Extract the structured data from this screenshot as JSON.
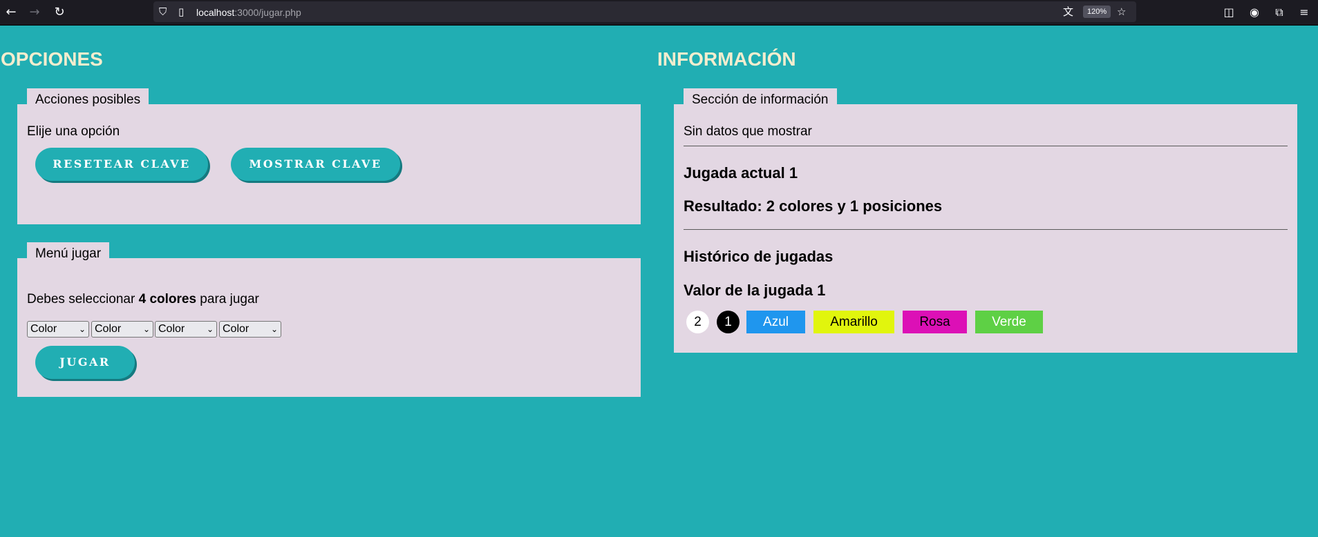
{
  "browser": {
    "url_host": "localhost",
    "url_path": ":3000/jugar.php",
    "zoom": "120%"
  },
  "opciones": {
    "title": "OPCIONES",
    "acciones": {
      "legend": "Acciones posibles",
      "prompt": "Elije una opción",
      "reset_label": "RESETEAR CLAVE",
      "show_label": "MOSTRAR CLAVE"
    },
    "menu": {
      "legend": "Menú jugar",
      "instr_before": "Debes seleccionar ",
      "instr_bold": "4 colores",
      "instr_after": " para jugar",
      "selects": [
        "Color",
        "Color",
        "Color",
        "Color"
      ],
      "play_label": "JUGAR"
    }
  },
  "informacion": {
    "title": "INFORMACIÓN",
    "legend": "Sección de información",
    "empty": "Sin datos que mostrar",
    "jugada_actual": "Jugada actual 1",
    "resultado": "Resultado: 2 colores y 1 posiciones",
    "historico": "Histórico de jugadas",
    "valor": "Valor de la jugada 1",
    "white_count": "2",
    "black_count": "1",
    "chips": [
      {
        "label": "Azul",
        "color": "#1f96ee"
      },
      {
        "label": "Amarillo",
        "color": "#e1f50d"
      },
      {
        "label": "Rosa",
        "color": "#dc10b6"
      },
      {
        "label": "Verde",
        "color": "#5ed045"
      }
    ]
  }
}
